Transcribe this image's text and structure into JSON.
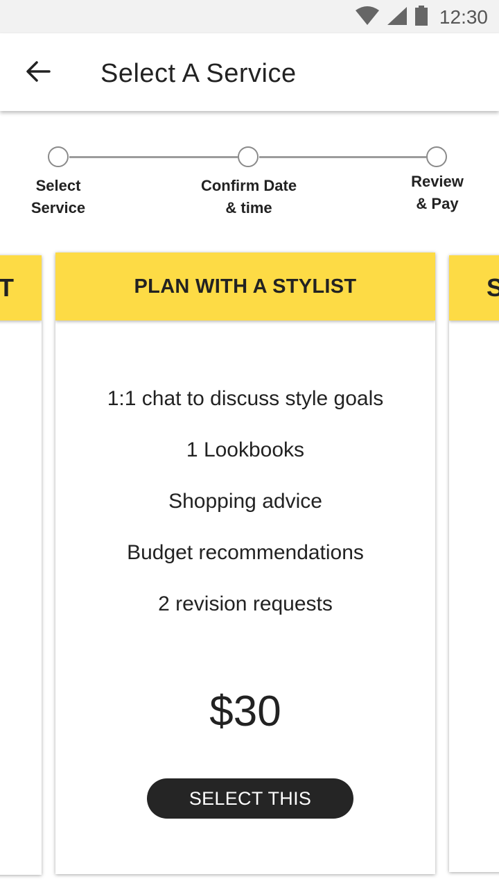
{
  "status_bar": {
    "time": "12:30",
    "icons": [
      "wifi-icon",
      "signal-icon",
      "battery-icon"
    ]
  },
  "app_bar": {
    "title": "Select A Service",
    "back_icon": "arrow-left-icon"
  },
  "stepper": {
    "steps": [
      {
        "label": "Select\nService"
      },
      {
        "label": "Confirm Date\n& time"
      },
      {
        "label": "Review\n& Pay"
      }
    ]
  },
  "cards": {
    "left_peek": {
      "header_fragment": "T"
    },
    "current": {
      "title": "PLAN WITH A STYLIST",
      "features": [
        "1:1 chat to discuss style goals",
        "1 Lookbooks",
        "Shopping advice",
        "Budget recommendations",
        "2 revision requests"
      ],
      "price": "$30",
      "button_label": "SELECT THIS"
    },
    "right_peek": {
      "header_fragment": "S"
    }
  },
  "colors": {
    "accent": "#fddb45",
    "button": "#252525",
    "button_text": "#ffffff"
  }
}
